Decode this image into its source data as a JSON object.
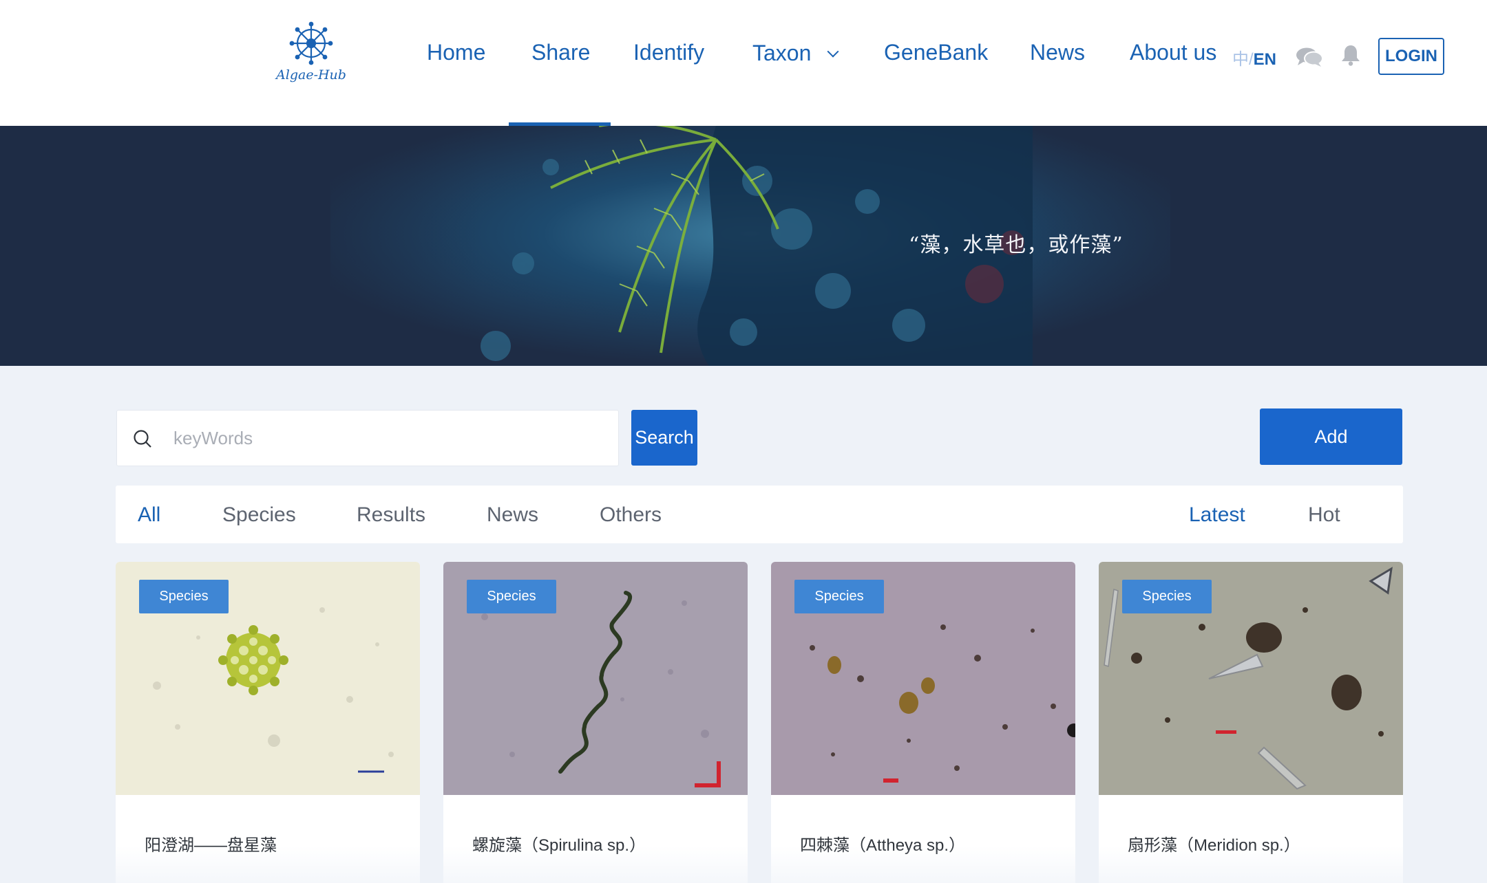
{
  "header": {
    "logo_text": "Algae-Hub",
    "nav": [
      {
        "label": "Home"
      },
      {
        "label": "Share",
        "active": true
      },
      {
        "label": "Identify"
      },
      {
        "label": "Taxon",
        "dropdown": true
      },
      {
        "label": "GeneBank"
      },
      {
        "label": "News"
      },
      {
        "label": "About us"
      }
    ],
    "lang_zh": "中",
    "lang_sep": "/",
    "lang_en": "EN",
    "login_label": "LOGIN"
  },
  "banner": {
    "quote": "“藻，水草也，或作藻”"
  },
  "search": {
    "placeholder": "keyWords",
    "button_label": "Search"
  },
  "add_label": "Add",
  "filters": {
    "categories": [
      "All",
      "Species",
      "Results",
      "News",
      "Others"
    ],
    "active_category": "All",
    "sort": [
      "Latest",
      "Hot"
    ],
    "active_sort": "Latest"
  },
  "cards": [
    {
      "badge": "Species",
      "title": "阳澄湖——盘星藻"
    },
    {
      "badge": "Species",
      "title": "螺旋藻（Spirulina sp.）"
    },
    {
      "badge": "Species",
      "title": "四棘藻（Attheya sp.）"
    },
    {
      "badge": "Species",
      "title": "扇形藻（Meridion sp.）"
    }
  ],
  "colors": {
    "brand": "#1a62b3",
    "button": "#1a66cc",
    "badge": "#3f86d4",
    "page_bg": "#eef2f8"
  },
  "icons": [
    "algae-hub-logo",
    "chevron-down-icon",
    "chat-icon",
    "bell-icon",
    "search-icon"
  ]
}
